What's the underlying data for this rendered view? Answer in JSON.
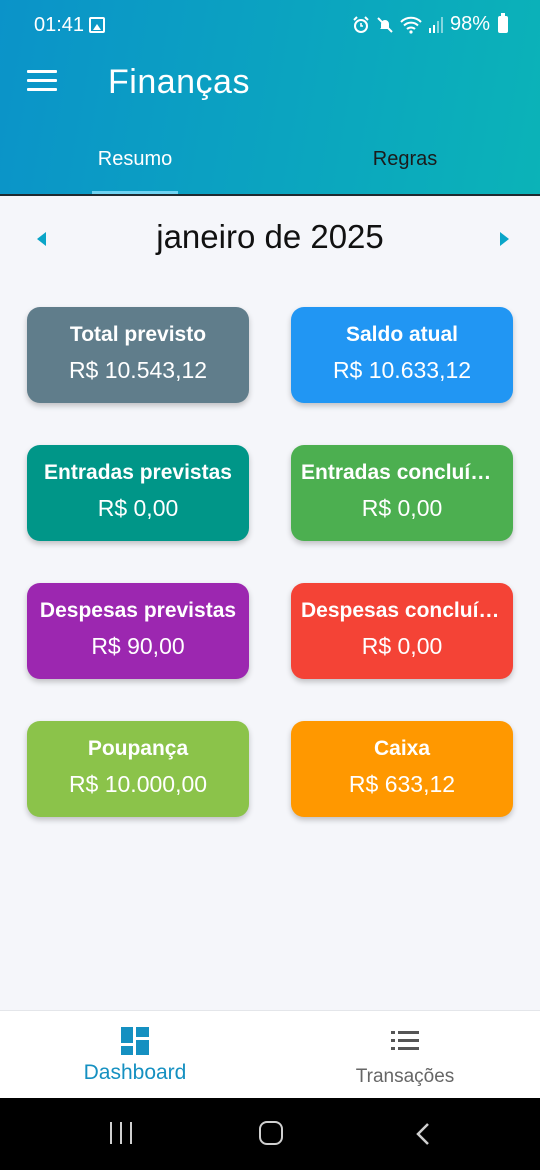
{
  "status_bar": {
    "time": "01:41",
    "battery": "98%"
  },
  "app_bar": {
    "title": "Finanças"
  },
  "tabs": [
    {
      "label": "Resumo",
      "active": true
    },
    {
      "label": "Regras",
      "active": false
    }
  ],
  "month_nav": {
    "label": "janeiro de 2025"
  },
  "cards": [
    {
      "title": "Total previsto",
      "value": "R$ 10.543,12",
      "color": "#607d8b"
    },
    {
      "title": "Saldo atual",
      "value": "R$ 10.633,12",
      "color": "#2196f3"
    },
    {
      "title": "Entradas previstas",
      "value": "R$ 0,00",
      "color": "#009688"
    },
    {
      "title": "Entradas concluídas",
      "value": "R$ 0,00",
      "color": "#4caf50"
    },
    {
      "title": "Despesas previstas",
      "value": "R$ 90,00",
      "color": "#9c27b0"
    },
    {
      "title": "Despesas concluídas",
      "value": "R$ 0,00",
      "color": "#f44336"
    },
    {
      "title": "Poupança",
      "value": "R$ 10.000,00",
      "color": "#8bc34a"
    },
    {
      "title": "Caixa",
      "value": "R$ 633,12",
      "color": "#ff9800"
    }
  ],
  "bottom_nav": [
    {
      "label": "Dashboard",
      "icon": "dashboard-icon",
      "active": true
    },
    {
      "label": "Transações",
      "icon": "list-icon",
      "active": false
    }
  ],
  "colors": {
    "accent": "#1590c1",
    "header_start": "#0b93c9",
    "header_end": "#0bb3b8",
    "background": "#f5f6fa"
  }
}
